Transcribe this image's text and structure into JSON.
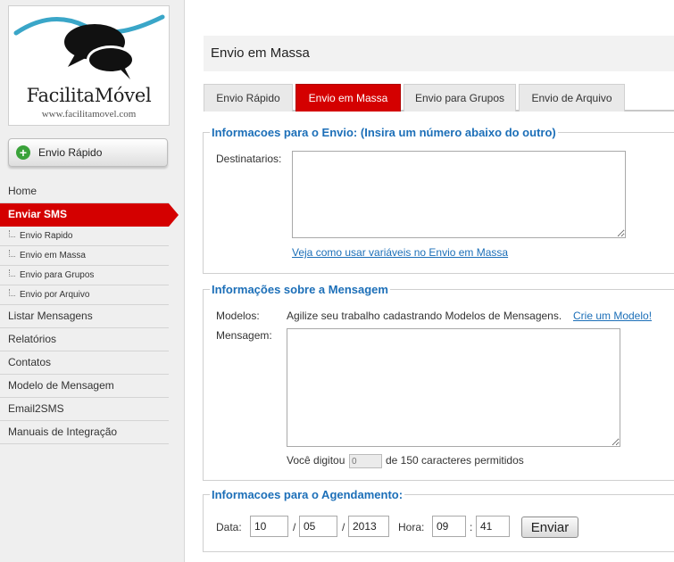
{
  "logo": {
    "name_part1": "Facilita",
    "name_part2": "Móvel",
    "url": "www.facilitamovel.com"
  },
  "sidebar": {
    "quick_button": {
      "icon": "plus-circle-icon",
      "label": "Envio Rápido"
    },
    "items": [
      {
        "label": "Home",
        "type": "item"
      },
      {
        "label": "Enviar SMS",
        "type": "item",
        "active": true
      },
      {
        "label": "Envio Rapido",
        "type": "sub"
      },
      {
        "label": "Envio em Massa",
        "type": "sub"
      },
      {
        "label": "Envio para Grupos",
        "type": "sub"
      },
      {
        "label": "Envio por Arquivo",
        "type": "sub"
      },
      {
        "label": "Listar Mensagens",
        "type": "item"
      },
      {
        "label": "Relatórios",
        "type": "item"
      },
      {
        "label": "Contatos",
        "type": "item"
      },
      {
        "label": "Modelo de Mensagem",
        "type": "item"
      },
      {
        "label": "Email2SMS",
        "type": "item"
      },
      {
        "label": "Manuais de Integração",
        "type": "item"
      }
    ]
  },
  "header": {
    "title": "Envio em Massa"
  },
  "tabs": [
    {
      "label": "Envio Rápido",
      "active": false
    },
    {
      "label": "Envio em Massa",
      "active": true
    },
    {
      "label": "Envio para Grupos",
      "active": false
    },
    {
      "label": "Envio de Arquivo",
      "active": false
    }
  ],
  "envio": {
    "legend": "Informacoes para o Envio: (Insira um número abaixo do outro)",
    "destinatarios_label": "Destinatarios:",
    "destinatarios_value": "",
    "variables_link": "Veja como usar variáveis no Envio em Massa"
  },
  "mensagem": {
    "legend": "Informações sobre a Mensagem",
    "modelos_label": "Modelos:",
    "modelos_text": "Agilize seu trabalho cadastrando Modelos de Mensagens.",
    "modelos_link": "Crie um Modelo!",
    "mensagem_label": "Mensagem:",
    "mensagem_value": "",
    "counter_prefix": "Você digitou",
    "counter_value": "0",
    "counter_suffix": "de 150 caracteres permitidos"
  },
  "agendamento": {
    "legend": "Informacoes para o Agendamento:",
    "data_label": "Data:",
    "day": "10",
    "month": "05",
    "year": "2013",
    "date_sep": "/",
    "hora_label": "Hora:",
    "hour": "09",
    "minute": "41",
    "time_sep": ":",
    "send_label": "Enviar"
  },
  "colors": {
    "accent_red": "#d40000",
    "link_blue": "#1c6fb8"
  }
}
